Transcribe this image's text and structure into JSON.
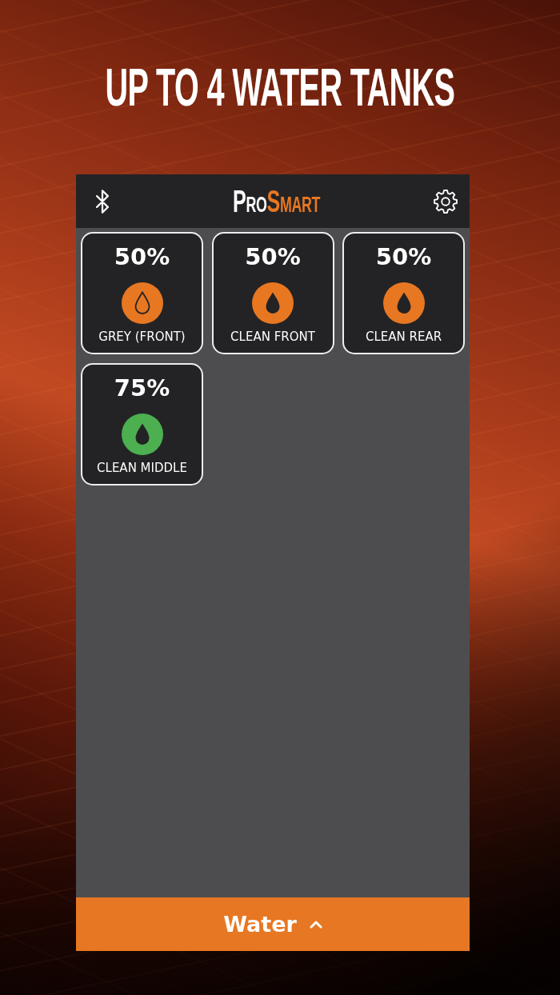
{
  "headline": "UP TO 4 WATER TANKS",
  "header": {
    "logo": [
      "Pro",
      "Smart"
    ]
  },
  "tanks": [
    {
      "reading": "50%",
      "kind": "outline",
      "color": "#e87722",
      "name": "GREY (FRONT)"
    },
    {
      "reading": "50%",
      "kind": "solid",
      "color": "#e87722",
      "name": "CLEAN FRONT"
    },
    {
      "reading": "50%",
      "kind": "solid",
      "color": "#e87722",
      "name": "CLEAN REAR"
    },
    {
      "reading": "75%",
      "kind": "solid",
      "color": "#4caf50",
      "name": "CLEAN MIDDLE"
    }
  ],
  "footer": {
    "label": "Water"
  }
}
